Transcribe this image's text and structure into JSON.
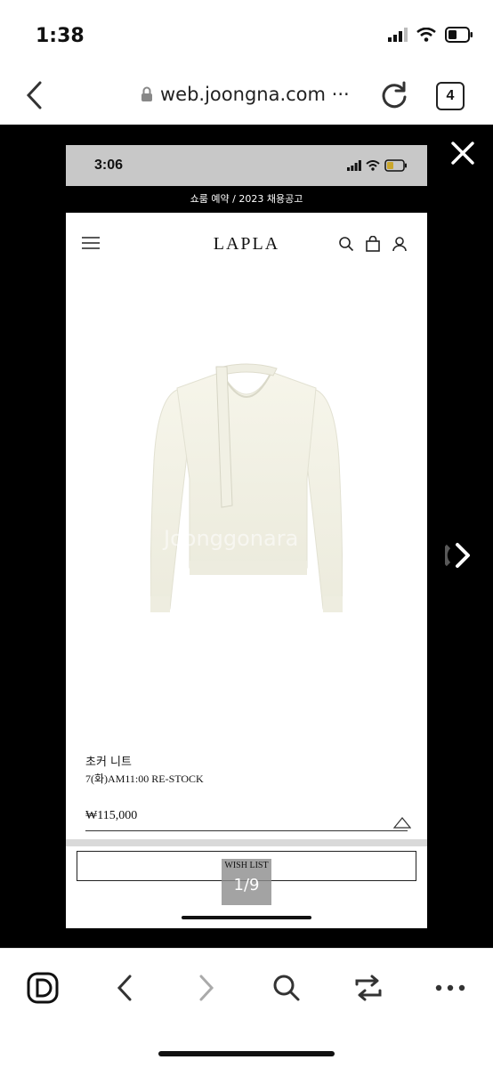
{
  "status": {
    "time": "1:38"
  },
  "browser": {
    "url": "web.joongna.com ···",
    "tab_count": "4"
  },
  "viewer": {
    "inner_status": {
      "time": "3:06"
    },
    "banner": "쇼룸 예약 / 2023 채용공고",
    "logo": "LAPLA",
    "watermark": "Joonggonara",
    "product": {
      "name": "초커 니트",
      "note": "7(화)AM11:00 RE-STOCK",
      "price": "₩115,000"
    },
    "wish_label": "WISH LIST",
    "pager": "1/9"
  },
  "colors": {
    "viewer_bg": "#000000",
    "inner_status_bg": "#c8c8c8",
    "sweater": "#f3f2e6"
  }
}
